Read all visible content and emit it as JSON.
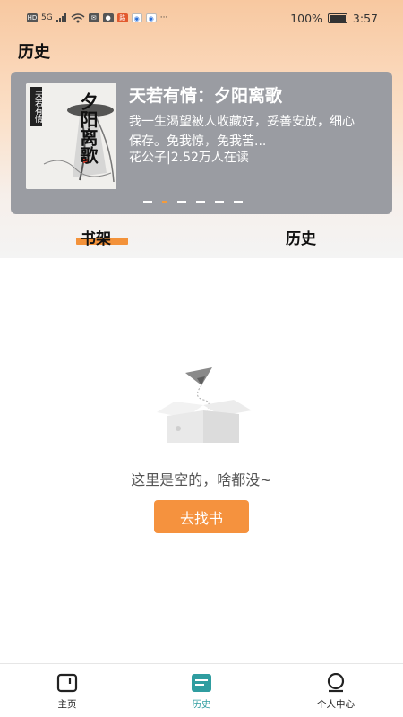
{
  "status_bar": {
    "left_icons": [
      "HD",
      "5G",
      "signal",
      "wifi",
      "mail",
      "app",
      "路",
      "app-1",
      "app-2",
      "···"
    ],
    "battery": "100%",
    "time": "3:57"
  },
  "header": {
    "title": "历史"
  },
  "banner": {
    "cover_vertical_text": "天若有情",
    "cover_title": "夕阳离歌",
    "title": "天若有情：夕阳离歌",
    "description": "我一生渴望被人收藏好，妥善安放，细心保存。免我惊，免我苦...",
    "meta": "花公子|2.52万人在读",
    "dot_count": 6,
    "active_dot": 1
  },
  "tabs": [
    {
      "label": "书架",
      "active": true
    },
    {
      "label": "历史",
      "active": false
    }
  ],
  "empty_state": {
    "message": "这里是空的，啥都没~",
    "button_label": "去找书"
  },
  "bottom_nav": [
    {
      "label": "主页",
      "icon": "home-icon",
      "active": false
    },
    {
      "label": "历史",
      "icon": "history-book-icon",
      "active": true
    },
    {
      "label": "个人中心",
      "icon": "profile-icon",
      "active": false
    }
  ],
  "colors": {
    "accent": "#f5923e",
    "nav_active": "#2f9da0",
    "banner_bg": "#9a9ca2"
  }
}
